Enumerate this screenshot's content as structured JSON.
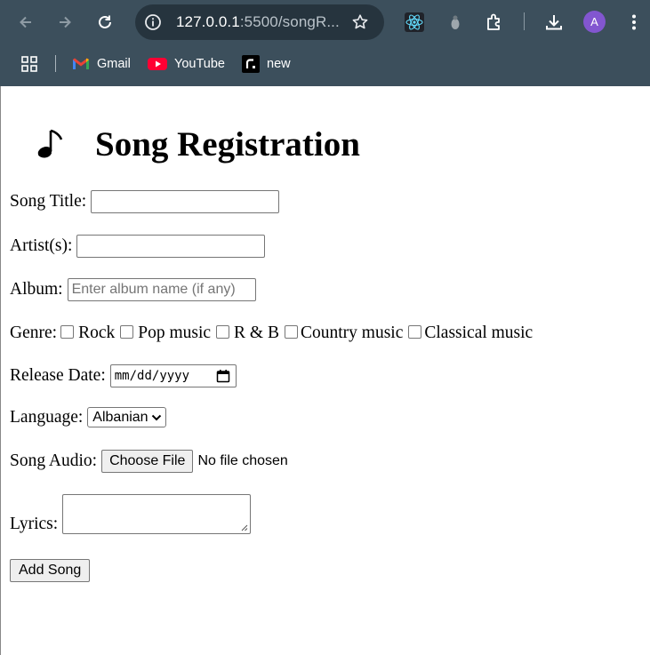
{
  "browser": {
    "url_host": "127.0.0.1",
    "url_path": ":5500/songR...",
    "profile_initial": "A",
    "bookmarks": [
      {
        "label": "Gmail",
        "icon": "gmail-icon"
      },
      {
        "label": "YouTube",
        "icon": "youtube-icon"
      },
      {
        "label": "new",
        "icon": "new-bookmark-icon"
      }
    ],
    "colors": {
      "chrome": "#3c4f5c",
      "omnibox": "#26343e",
      "avatar": "#8256d0"
    }
  },
  "page": {
    "heading": "Song Registration",
    "heading_icon": "music-note-icon",
    "song_title": {
      "label": "Song Title:",
      "value": ""
    },
    "artists": {
      "label": "Artist(s):",
      "value": ""
    },
    "album": {
      "label": "Album:",
      "placeholder": "Enter album name (if any)",
      "value": ""
    },
    "genre": {
      "label": "Genre:",
      "options": [
        "Rock",
        "Pop music",
        "R & B",
        "Country music",
        "Classical music"
      ]
    },
    "release_date": {
      "label": "Release Date:",
      "placeholder": "mm/dd/yyyy"
    },
    "language": {
      "label": "Language:",
      "selected": "Albanian"
    },
    "song_audio": {
      "label": "Song Audio:",
      "button": "Choose File",
      "status": "No file chosen"
    },
    "lyrics": {
      "label": "Lyrics:",
      "value": ""
    },
    "submit": "Add Song"
  }
}
